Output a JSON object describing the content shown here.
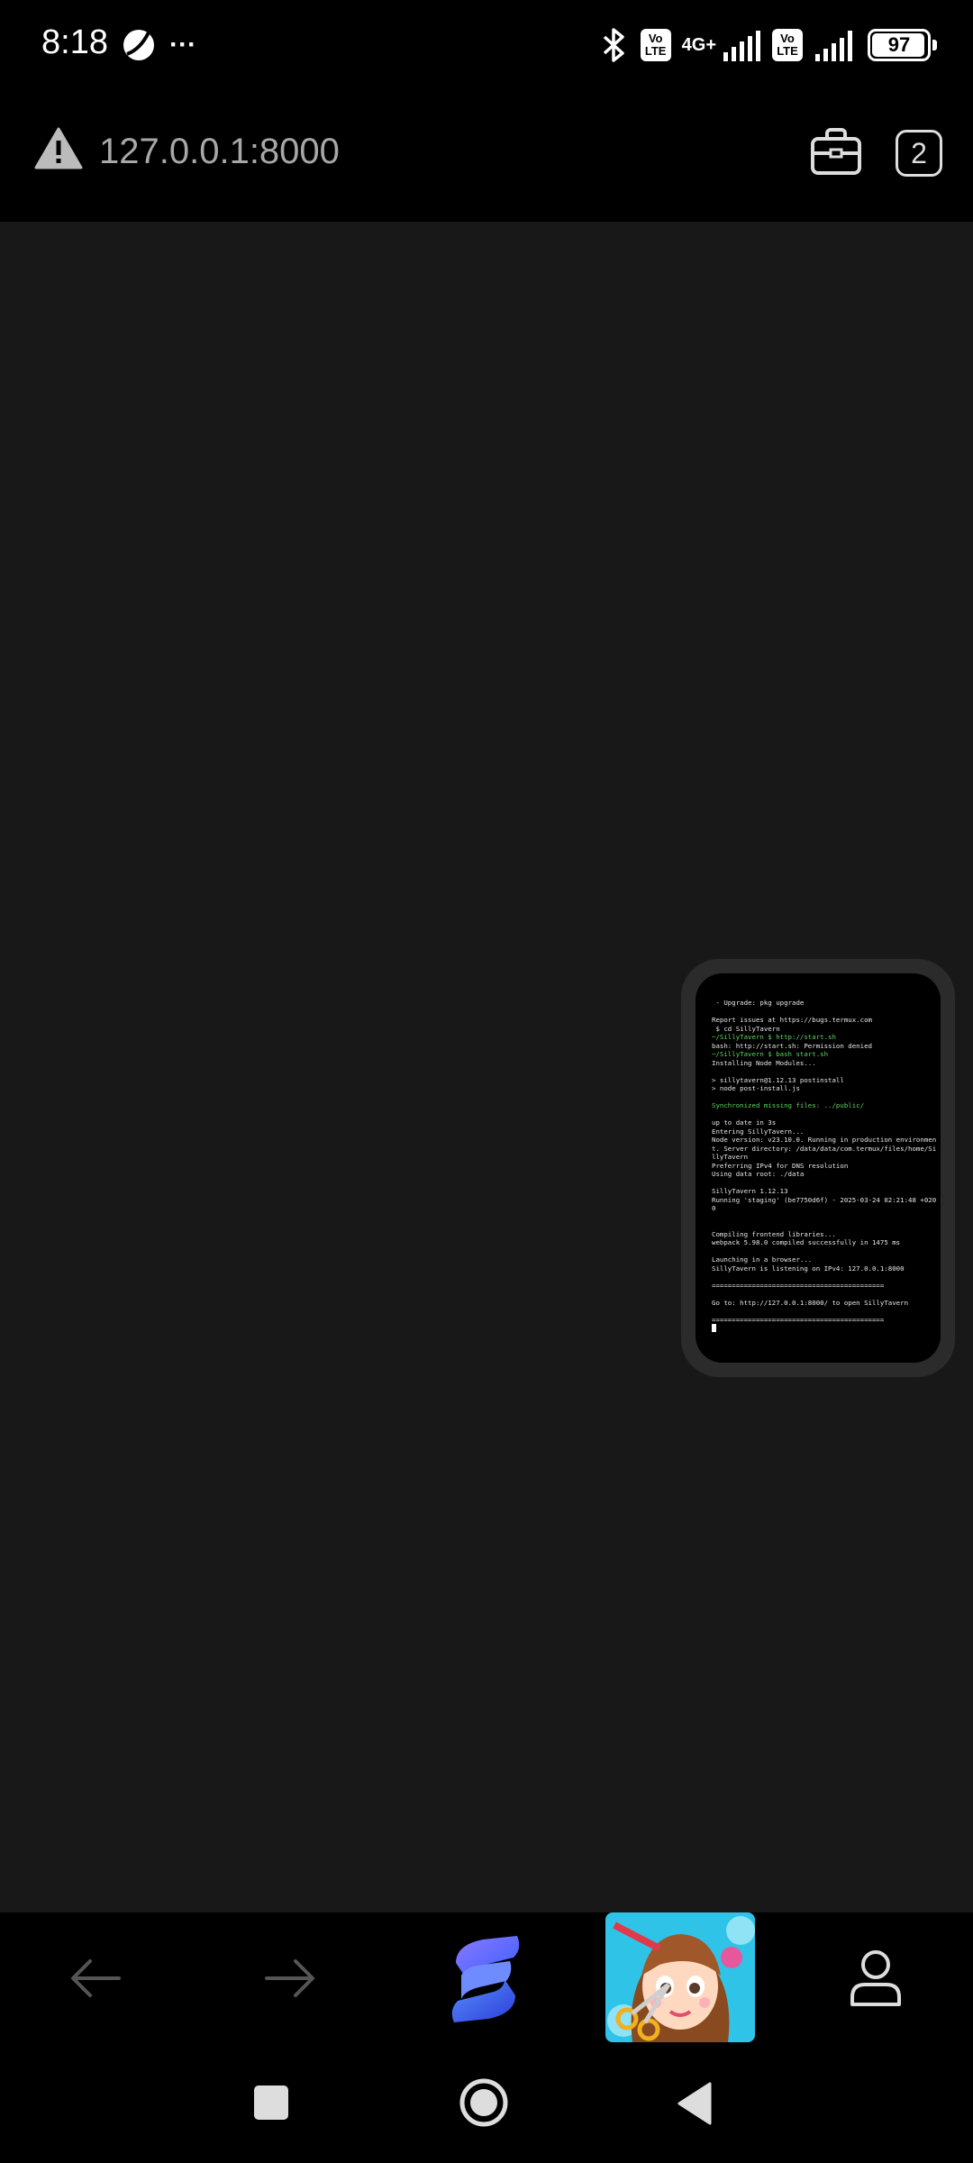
{
  "status_bar": {
    "time": "8:18",
    "more_indicator": "···",
    "sim1": {
      "volte_top": "Vo",
      "volte_bottom": "LTE",
      "network": "4G+"
    },
    "sim2": {
      "volte_top": "Vo",
      "volte_bottom": "LTE"
    },
    "battery_level": "97",
    "icons": [
      "moon-icon",
      "bluetooth-icon",
      "signal-icon",
      "battery-icon"
    ]
  },
  "address_bar": {
    "url": "127.0.0.1:8000",
    "tab_count": "2",
    "icons": [
      "warning-icon",
      "toolbox-icon"
    ]
  },
  "terminal_preview": {
    "lines": [
      " - Upgrade: pkg upgrade",
      "",
      "Report issues at https://bugs.termux.com",
      " $ cd SillyTavern",
      "~/SillyTavern $ http://start.sh",
      "bash: http://start.sh: Permission denied",
      "~/SillyTavern $ bash start.sh",
      "Installing Node Modules...",
      "",
      "> sillytavern@1.12.13 postinstall",
      "> node post-install.js",
      "",
      "Synchronized missing files: ../public/",
      "",
      "up to date in 3s",
      "Entering SillyTavern...",
      "Node version: v23.10.0. Running in production environmen",
      "t. Server directory: /data/data/com.termux/files/home/Si",
      "llyTavern",
      "Preferring IPv4 for DNS resolution",
      "Using data root: ./data",
      "",
      "SillyTavern 1.12.13",
      "Running 'staging' (be7750d6f) - 2025-03-24 02:21:48 +020",
      "0",
      "",
      "",
      "Compiling frontend libraries...",
      "webpack 5.98.0 compiled successfully in 1475 ms",
      "",
      "Launching in a browser...",
      "SillyTavern is listening on IPv4: 127.0.0.1:8000",
      "",
      "===========================================",
      "",
      "Go to: http://127.0.0.1:8000/ to open SillyTavern",
      "",
      "==========================================="
    ]
  },
  "bottom_nav": {
    "icons": [
      "back-arrow-icon",
      "forward-arrow-icon",
      "app-logo-icon",
      "profile-icon"
    ]
  },
  "system_nav": {
    "icons": [
      "recent-apps-icon",
      "home-icon",
      "back-triangle-icon"
    ]
  },
  "colors": {
    "background": "#000000",
    "content": "#181818",
    "terminal_green": "#5fd75f",
    "terminal_blue": "#6f8cff"
  }
}
